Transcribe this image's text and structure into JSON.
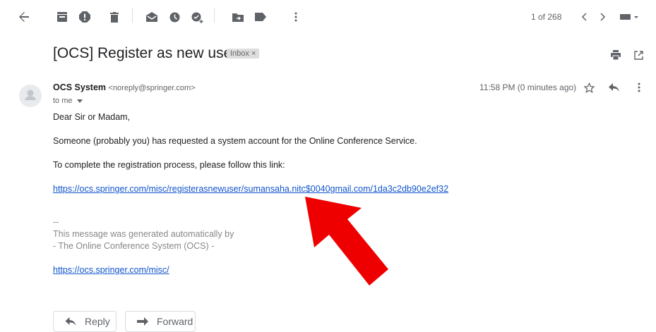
{
  "toolbar": {
    "icons": [
      "back-arrow-icon",
      "archive-icon",
      "report-spam-icon",
      "delete-icon",
      "mark-unread-icon",
      "snooze-icon",
      "add-task-icon",
      "move-to-icon",
      "label-icon",
      "more-vert-icon"
    ],
    "pager": "1 of 268"
  },
  "email": {
    "subject": "[OCS] Register as new user",
    "label_chip": "Inbox",
    "label_close": "×",
    "sender_name": "OCS System",
    "sender_email": "<noreply@springer.com>",
    "to_line": "to me",
    "timestamp": "11:58 PM (0 minutes ago)",
    "greeting": "Dear Sir or Madam,",
    "line1": "Someone (probably you) has requested a system account for the Online Conference Service.",
    "line2": "To complete the registration process, please follow this link:",
    "link": "https://ocs.springer.com/misc/registerasnewuser/sumansaha.nitc$0040gmail.com/1da3c2db90e2ef32",
    "sig_dash": "--",
    "sig_line1": "This message was generated automatically by",
    "sig_line2": "- The Online Conference System (OCS) -",
    "sig_link": "https://ocs.springer.com/misc/"
  },
  "actions": {
    "reply_label": "Reply",
    "forward_label": "Forward"
  },
  "colors": {
    "arrow": "#ee0000",
    "link": "#1155cc"
  }
}
